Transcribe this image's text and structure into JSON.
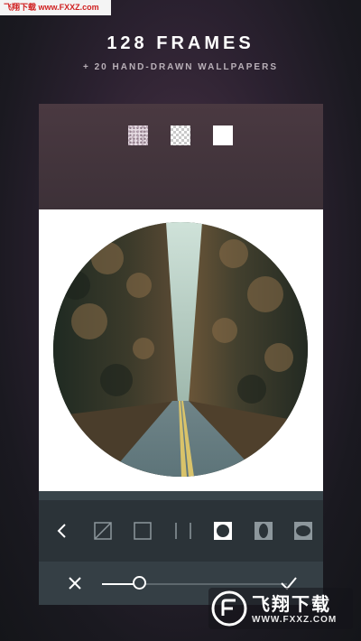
{
  "watermark": {
    "top_text": "飞翔下载 www.FXXZ.com",
    "badge_title": "飞翔下载",
    "badge_url": "WWW.FXXZ.COM"
  },
  "promo": {
    "title": "128 FRAMES",
    "subtitle": "+ 20 HAND-DRAWN WALLPAPERS"
  },
  "swatches": [
    {
      "name": "speckle-texture"
    },
    {
      "name": "checker-transparent"
    },
    {
      "name": "solid-white"
    }
  ],
  "frame_tools": [
    {
      "icon": "back-chevron-icon"
    },
    {
      "icon": "diagonal-frame-icon"
    },
    {
      "icon": "square-frame-icon"
    },
    {
      "icon": "side-bars-frame-icon"
    },
    {
      "icon": "circle-frame-icon",
      "selected": true
    },
    {
      "icon": "oval-frame-icon"
    },
    {
      "icon": "rounded-frame-icon"
    }
  ],
  "slider": {
    "value": 0.2
  },
  "colors": {
    "accent": "#ffffff",
    "toolbar": "#2b3338",
    "bottom_bar": "#353f45"
  }
}
